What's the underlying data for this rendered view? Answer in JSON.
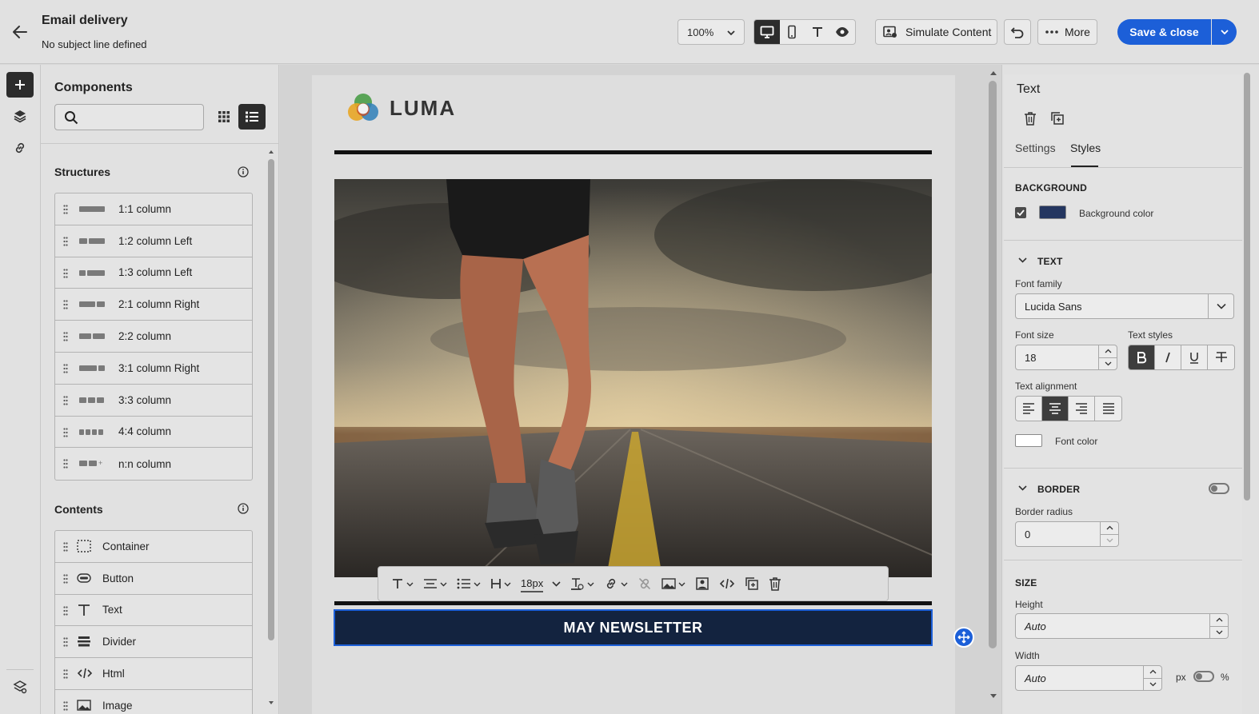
{
  "header": {
    "title": "Email delivery",
    "subtitle": "No subject line defined",
    "zoom": "100%",
    "simulate_label": "Simulate Content",
    "more_label": "More",
    "save_label": "Save & close"
  },
  "components": {
    "title": "Components",
    "search_placeholder": "",
    "structures_title": "Structures",
    "structures": [
      {
        "label": "1:1 column"
      },
      {
        "label": "1:2 column Left"
      },
      {
        "label": "1:3 column Left"
      },
      {
        "label": "2:1 column Right"
      },
      {
        "label": "2:2 column"
      },
      {
        "label": "3:1 column Right"
      },
      {
        "label": "3:3 column"
      },
      {
        "label": "4:4 column"
      },
      {
        "label": "n:n column"
      }
    ],
    "contents_title": "Contents",
    "contents": [
      {
        "label": "Container",
        "icon": "container-icon"
      },
      {
        "label": "Button",
        "icon": "button-icon"
      },
      {
        "label": "Text",
        "icon": "text-icon"
      },
      {
        "label": "Divider",
        "icon": "divider-icon"
      },
      {
        "label": "Html",
        "icon": "html-icon"
      },
      {
        "label": "Image",
        "icon": "image-icon"
      }
    ]
  },
  "email": {
    "logo_text": "LUMA",
    "newsletter_text": "MAY NEWSLETTER",
    "toolbar_font_size": "18px",
    "text_block_bg": "#13233f"
  },
  "properties": {
    "title": "Text",
    "tabs": [
      "Settings",
      "Styles"
    ],
    "active_tab": "Styles",
    "background_head": "BACKGROUND",
    "background_color_label": "Background color",
    "background_color": "#243660",
    "text_head": "TEXT",
    "font_family_label": "Font family",
    "font_family_value": "Lucida Sans",
    "font_size_label": "Font size",
    "font_size_value": "18",
    "text_styles_label": "Text styles",
    "text_alignment_label": "Text alignment",
    "font_color_label": "Font color",
    "border_head": "BORDER",
    "border_radius_label": "Border radius",
    "border_radius_value": "0",
    "size_head": "SIZE",
    "height_label": "Height",
    "height_value": "Auto",
    "width_label": "Width",
    "width_value": "Auto",
    "unit_px": "px",
    "unit_percent": "%"
  },
  "colors": {
    "accent": "#1c5fd8",
    "dark": "#2c2c2c"
  }
}
